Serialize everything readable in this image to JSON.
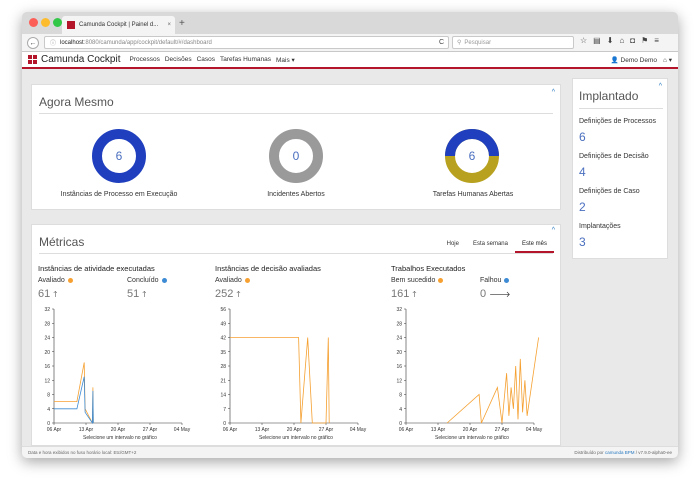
{
  "browser": {
    "tab_title": "Camunda Cockpit | Painel d...",
    "tab_close": "×",
    "new_tab": "+",
    "url_host": "localhost",
    "url_rest": ":8080/camunda/app/cockpit/default/#/dashboard",
    "reload": "C",
    "search_placeholder": "Pesquisar",
    "colors": {
      "close": "#fc5f57",
      "minimize": "#fdbc2e",
      "maximize": "#33c748"
    }
  },
  "nav": {
    "brand": "Camunda Cockpit",
    "items": [
      "Processos",
      "Decisões",
      "Casos",
      "Tarefas Humanas",
      "Mais ▾"
    ],
    "user": "Demo Demo",
    "home": "⌂ ▾",
    "accent": "#b5152b"
  },
  "now": {
    "title": "Agora Mesmo",
    "donuts": [
      {
        "value": "6",
        "label": "Instâncias de Processo em Execução"
      },
      {
        "value": "0",
        "label": "Incidentes Abertos"
      },
      {
        "value": "6",
        "label": "Tarefas Humanas Abertas"
      }
    ],
    "colors": {
      "blue": "#1f3fbf",
      "grey": "#9a9a9a",
      "gold": "#b8a11f"
    }
  },
  "metrics": {
    "title": "Métricas",
    "tabs": [
      "Hoje",
      "Esta semana",
      "Este mês"
    ],
    "active_tab": "Este mês",
    "select_hint": "Selecione um intervalo no gráfico",
    "cards": [
      {
        "title": "Instâncias de atividade executadas",
        "a_label": "Avaliado",
        "a_value": "61",
        "b_label": "Concluído",
        "b_value": "51"
      },
      {
        "title": "Instâncias de decisão avaliadas",
        "a_label": "Avaliado",
        "a_value": "252",
        "b_label": "",
        "b_value": ""
      },
      {
        "title": "Trabalhos Executados",
        "a_label": "Bem sucedido",
        "a_value": "161",
        "b_label": "Falhou",
        "b_value": "0"
      }
    ]
  },
  "deployed": {
    "title": "Implantado",
    "items": [
      {
        "label": "Definições de Processos",
        "value": "6"
      },
      {
        "label": "Definições de Decisão",
        "value": "4"
      },
      {
        "label": "Definições de Caso",
        "value": "2"
      },
      {
        "label": "Implantações",
        "value": "3"
      }
    ]
  },
  "footer": {
    "left": "Data e hora exibidos no fuso horário local: Etc/GMT+2",
    "right_prefix": "Distribuído por",
    "right_link": "camunda BPM",
    "right_suffix": "/ v7.9.0-alpha0-ee"
  },
  "chart_data": [
    {
      "type": "line",
      "title": "Instâncias de atividade executadas",
      "x_ticks": [
        "06 Apr",
        "13 Apr",
        "20 Apr",
        "27 Apr",
        "04 May"
      ],
      "y_ticks": [
        0,
        4,
        8,
        12,
        16,
        20,
        24,
        28,
        32
      ],
      "ylim": [
        0,
        32
      ],
      "series": [
        {
          "name": "Avaliado",
          "color": "#f5a030",
          "points": [
            [
              0,
              6
            ],
            [
              5,
              6
            ],
            [
              6.6,
              17
            ],
            [
              6.8,
              4
            ],
            [
              8.4,
              0
            ],
            [
              8.5,
              10
            ],
            [
              8.6,
              0
            ]
          ]
        },
        {
          "name": "Concluído",
          "color": "#3d8bd4",
          "points": [
            [
              0,
              4
            ],
            [
              5,
              4
            ],
            [
              6.6,
              13
            ],
            [
              6.8,
              3
            ],
            [
              8.4,
              0
            ],
            [
              8.5,
              9
            ],
            [
              8.6,
              0
            ]
          ]
        }
      ]
    },
    {
      "type": "line",
      "title": "Instâncias de decisão avaliadas",
      "x_ticks": [
        "06 Apr",
        "13 Apr",
        "20 Apr",
        "27 Apr",
        "04 May"
      ],
      "y_ticks": [
        0,
        7,
        14,
        21,
        28,
        35,
        42,
        49,
        56
      ],
      "ylim": [
        0,
        56
      ],
      "series": [
        {
          "name": "Avaliado",
          "color": "#f5a030",
          "points": [
            [
              0,
              42
            ],
            [
              15,
              42
            ],
            [
              15.5,
              0
            ],
            [
              17,
              42
            ],
            [
              18,
              0
            ],
            [
              21,
              0
            ],
            [
              21.5,
              42
            ],
            [
              21.7,
              0
            ]
          ]
        }
      ]
    },
    {
      "type": "line",
      "title": "Trabalhos Executados",
      "x_ticks": [
        "06 Apr",
        "13 Apr",
        "20 Apr",
        "27 Apr",
        "04 May"
      ],
      "y_ticks": [
        0,
        4,
        8,
        12,
        16,
        20,
        24,
        28,
        32
      ],
      "ylim": [
        0,
        32
      ],
      "series": [
        {
          "name": "Bem sucedido",
          "color": "#f5a030",
          "points": [
            [
              9,
              0
            ],
            [
              16,
              8
            ],
            [
              16.5,
              0
            ],
            [
              20,
              10
            ],
            [
              21,
              0
            ],
            [
              22,
              14
            ],
            [
              22.5,
              2
            ],
            [
              23,
              10
            ],
            [
              23.5,
              4
            ],
            [
              24,
              16
            ],
            [
              24.5,
              1
            ],
            [
              25,
              18
            ],
            [
              25.5,
              3
            ],
            [
              26,
              12
            ],
            [
              26.5,
              2
            ],
            [
              29,
              24
            ]
          ]
        },
        {
          "name": "Falhou",
          "color": "#3d8bd4",
          "points": []
        }
      ]
    }
  ]
}
